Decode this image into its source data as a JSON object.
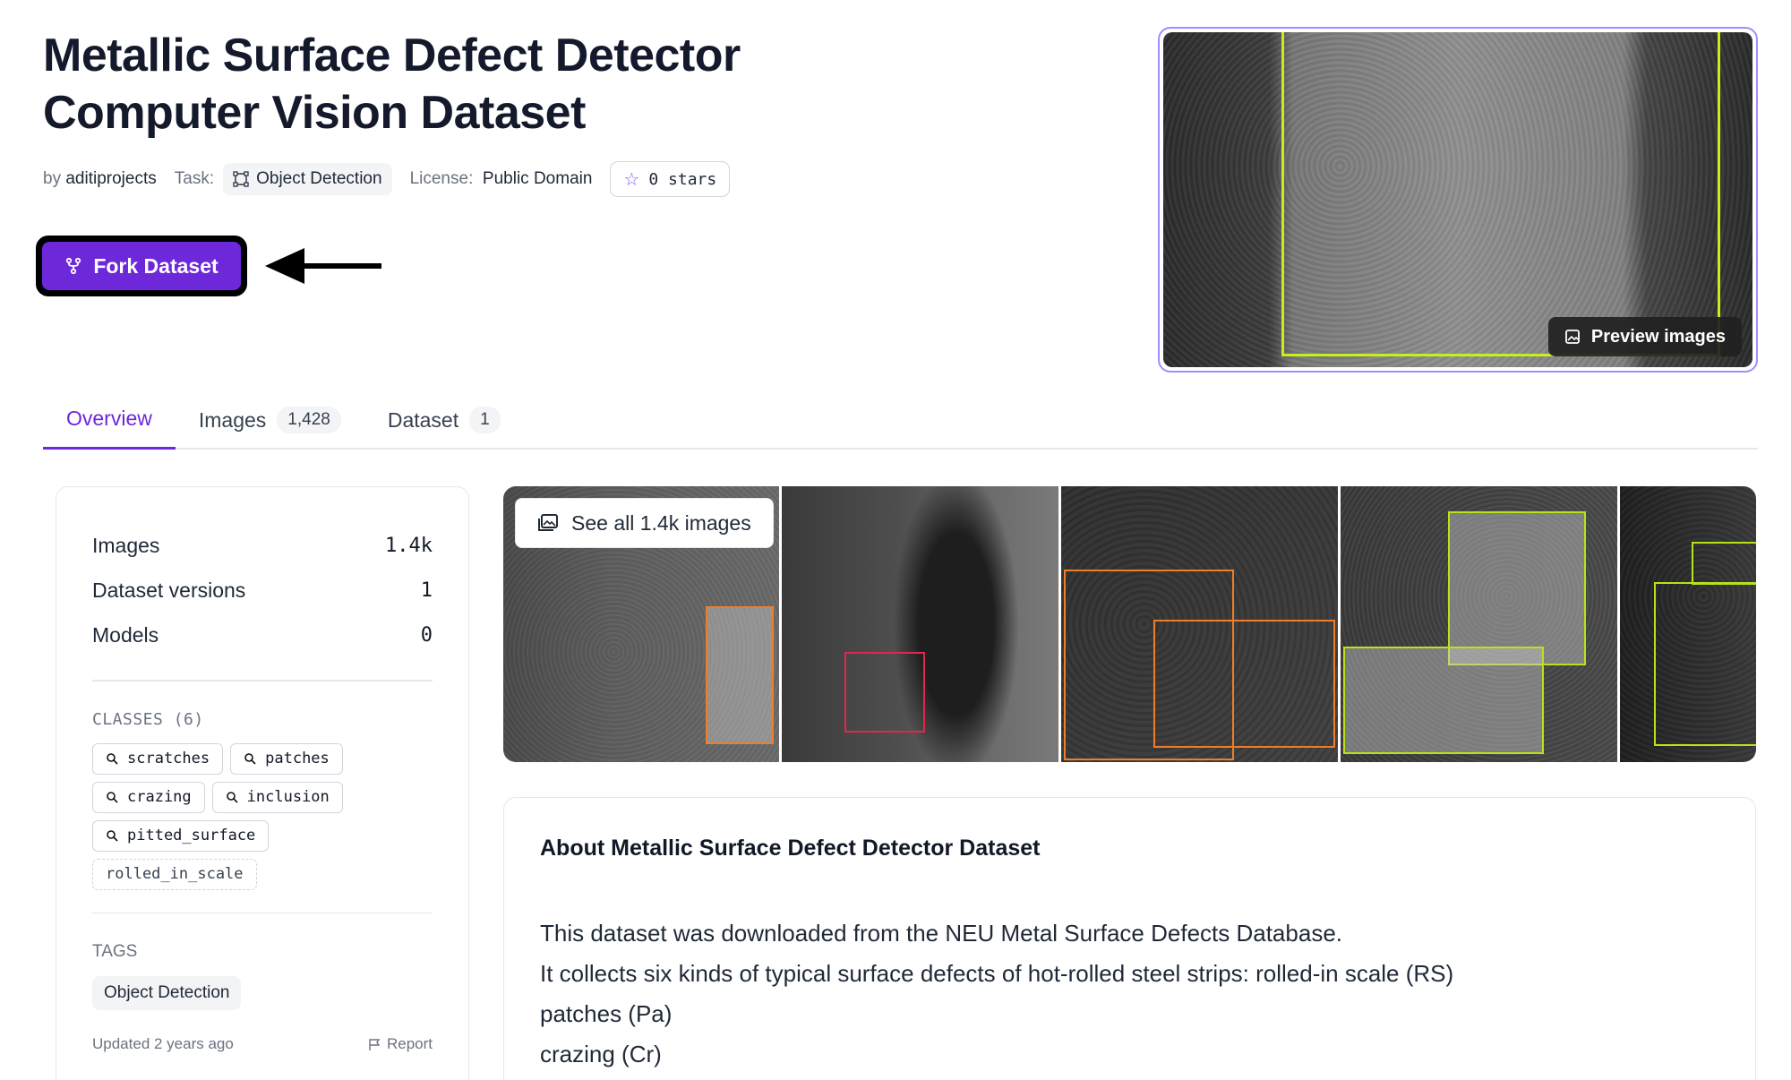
{
  "header": {
    "title": "Metallic Surface Defect Detector Computer Vision Dataset",
    "by_label": "by",
    "author": "aditiprojects",
    "task_label": "Task:",
    "task": "Object Detection",
    "license_label": "License:",
    "license": "Public Domain",
    "stars": "0 stars",
    "fork_label": "Fork Dataset",
    "preview_label": "Preview images"
  },
  "tabs": [
    {
      "label": "Overview",
      "count": ""
    },
    {
      "label": "Images",
      "count": "1,428"
    },
    {
      "label": "Dataset",
      "count": "1"
    }
  ],
  "sidebar": {
    "stats": [
      {
        "label": "Images",
        "value": "1.4k"
      },
      {
        "label": "Dataset versions",
        "value": "1"
      },
      {
        "label": "Models",
        "value": "0"
      }
    ],
    "classes_label": "CLASSES (6)",
    "classes": [
      "scratches",
      "patches",
      "crazing",
      "inclusion",
      "pitted_surface",
      "rolled_in_scale"
    ],
    "tags_label": "TAGS",
    "tags": [
      "Object Detection"
    ],
    "updated": "Updated 2 years ago",
    "report": "Report"
  },
  "gallery": {
    "see_all": "See all 1.4k images"
  },
  "about": {
    "heading": "About Metallic Surface Defect Detector Dataset",
    "lines": [
      "This dataset was downloaded from the NEU Metal Surface Defects Database.",
      "It collects six kinds of typical surface defects of hot-rolled steel strips: rolled-in scale (RS)",
      "patches (Pa)",
      "crazing (Cr)"
    ]
  },
  "colors": {
    "accent": "#6d28d9",
    "box_orange": "#ef7d2a",
    "box_red": "#e3264b",
    "box_green": "#b6e31a"
  }
}
